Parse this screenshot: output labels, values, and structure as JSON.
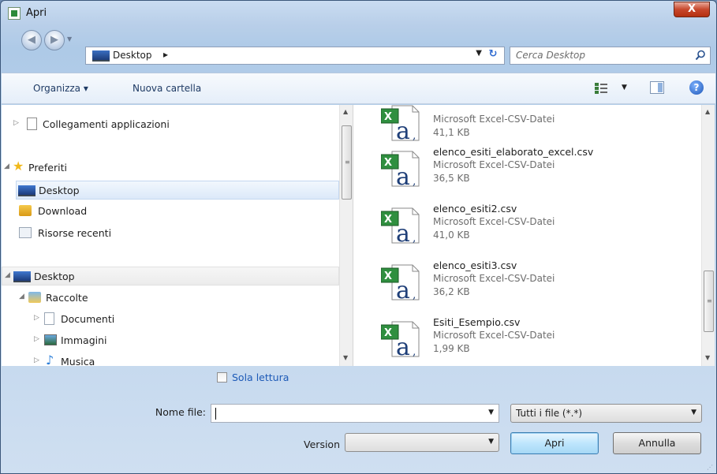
{
  "window": {
    "title": "Apri",
    "close_glyph": "X"
  },
  "address": {
    "location": "Desktop",
    "separator": "▸",
    "search_placeholder": "Cerca Desktop"
  },
  "toolbar": {
    "organize": "Organizza ▾",
    "new_folder": "Nuova cartella",
    "help": "?"
  },
  "nav_tree": [
    {
      "label": "Collegamenti applicazioni",
      "icon": "document-icon"
    },
    {
      "label": "Preferiti",
      "icon": "star-icon"
    },
    {
      "label": "Desktop",
      "icon": "desktop-icon"
    },
    {
      "label": "Download",
      "icon": "download-folder-icon"
    },
    {
      "label": "Risorse recenti",
      "icon": "recent-places-icon"
    },
    {
      "label": "Desktop",
      "icon": "desktop-icon"
    },
    {
      "label": "Raccolte",
      "icon": "libraries-icon"
    },
    {
      "label": "Documenti",
      "icon": "documents-icon"
    },
    {
      "label": "Immagini",
      "icon": "pictures-icon"
    },
    {
      "label": "Musica",
      "icon": "music-icon"
    }
  ],
  "files": [
    {
      "name": "",
      "type": "Microsoft Excel-CSV-Datei",
      "size": "41,1 KB"
    },
    {
      "name": "elenco_esiti_elaborato_excel.csv",
      "type": "Microsoft Excel-CSV-Datei",
      "size": "36,5 KB"
    },
    {
      "name": "elenco_esiti2.csv",
      "type": "Microsoft Excel-CSV-Datei",
      "size": "41,0 KB"
    },
    {
      "name": "elenco_esiti3.csv",
      "type": "Microsoft Excel-CSV-Datei",
      "size": "36,2 KB"
    },
    {
      "name": "Esiti_Esempio.csv",
      "type": "Microsoft Excel-CSV-Datei",
      "size": "1,99 KB"
    }
  ],
  "bottom": {
    "read_only": "Sola lettura",
    "filename_label": "Nome file:",
    "filename_value": "",
    "filetype_value": "Tutti i file (*.*)",
    "version_label": "Version",
    "version_value": "",
    "open_button": "Apri",
    "cancel_button": "Annulla"
  },
  "colors": {
    "accent": "#1d5ab7",
    "selection": "#dce9f9",
    "close": "#c7472c"
  }
}
